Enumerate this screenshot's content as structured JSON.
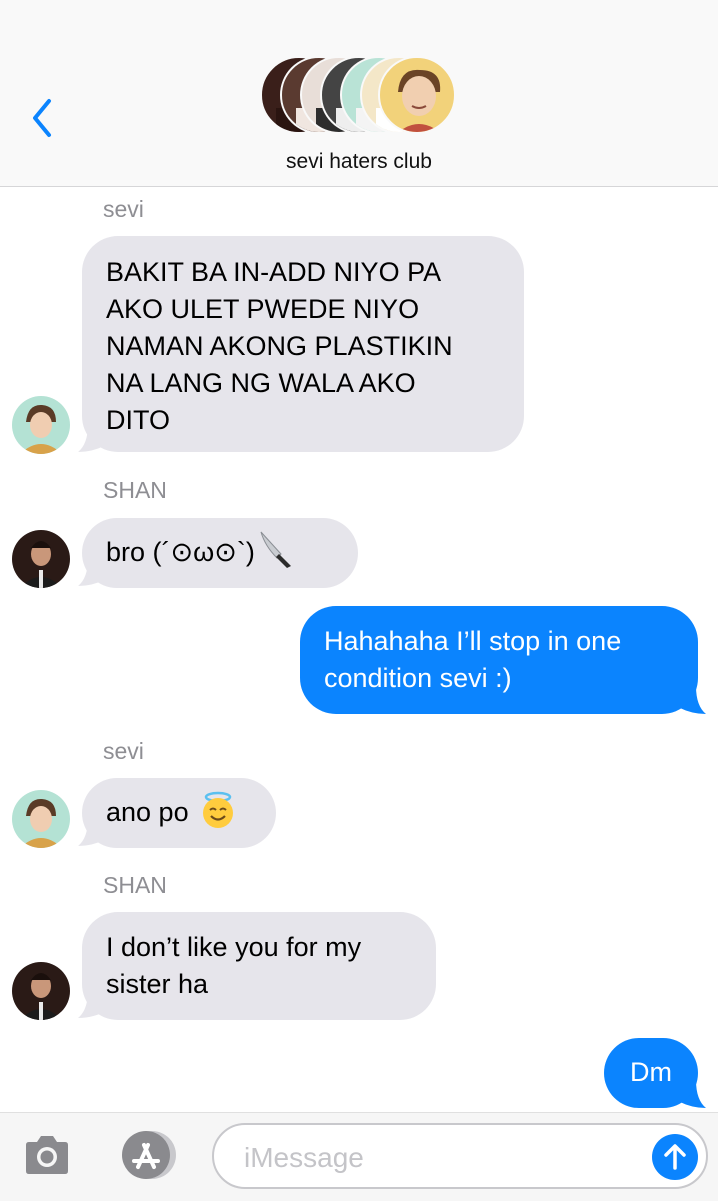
{
  "header": {
    "group_title": "sevi haters club",
    "back_icon": "chevron-left-icon",
    "accent": "#0b84fe"
  },
  "messages": [
    {
      "type": "incoming",
      "sender": "sevi",
      "avatar": "sevi-avatar",
      "lines": [
        "BAKIT BA IN-ADD NIYO PA",
        "AKO ULET PWEDE NIYO",
        "NAMAN AKONG PLASTIKIN",
        "NA LANG NG WALA AKO",
        "DITO"
      ]
    },
    {
      "type": "incoming",
      "sender": "SHAN",
      "avatar": "shan-avatar",
      "text": "bro (´⊙ω⊙`)",
      "emoji_icon": "knife-icon"
    },
    {
      "type": "outgoing",
      "lines": [
        "Hahahaha I’ll stop in one",
        "condition sevi :)"
      ]
    },
    {
      "type": "incoming",
      "sender": "sevi",
      "avatar": "sevi-avatar",
      "text": "ano po",
      "emoji_icon": "smiling-face-with-halo-icon"
    },
    {
      "type": "incoming",
      "sender": "SHAN",
      "avatar": "shan-avatar",
      "lines": [
        "I don’t like you for my",
        "sister ha"
      ]
    },
    {
      "type": "outgoing",
      "text": "Dm"
    }
  ],
  "input": {
    "placeholder": "iMessage",
    "camera_icon": "camera-icon",
    "appstore_icon": "app-store-icon",
    "send_icon": "send-arrow-up-icon"
  },
  "colors": {
    "incoming_bubble": "#e6e5eb",
    "outgoing_bubble": "#0b84fe",
    "sender_label": "#8e8e93"
  }
}
